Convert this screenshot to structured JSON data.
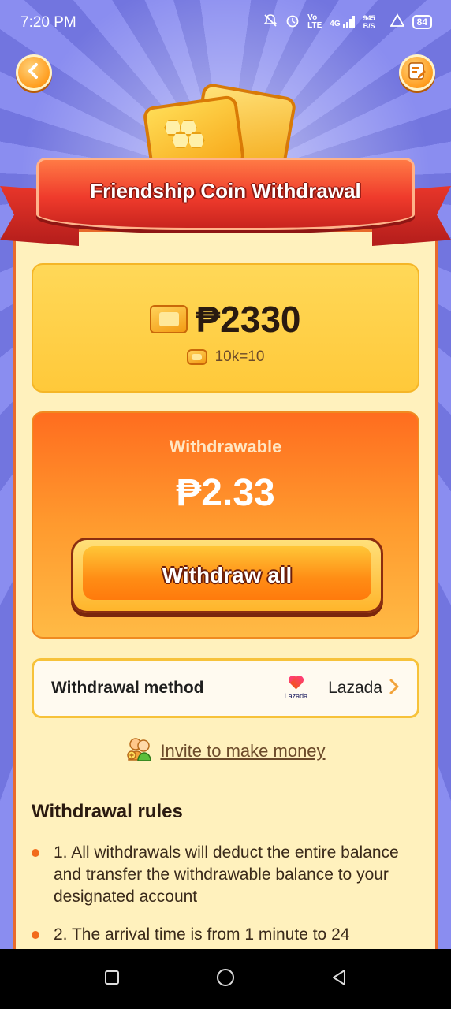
{
  "status_bar": {
    "time": "7:20 PM",
    "network": "4G",
    "speed": "945 B/S",
    "battery": "84"
  },
  "header": {
    "title": "Friendship Coin Withdrawal"
  },
  "balance": {
    "amount": "₱2330",
    "rate": "10k=10"
  },
  "withdrawable": {
    "label": "Withdrawable",
    "amount": "₱2.33",
    "button_label": "Withdraw all"
  },
  "method": {
    "label": "Withdrawal method",
    "logo_text": "Lazada",
    "value": "Lazada"
  },
  "invite": {
    "label": "Invite to make money"
  },
  "rules": {
    "title": "Withdrawal rules",
    "items": [
      "1. All withdrawals will deduct the entire balance and transfer the withdrawable balance to your designated account",
      "2. The arrival time is from 1 minute to 24"
    ]
  },
  "colors": {
    "accent_orange": "#ff7a0c",
    "ribbon_red": "#ef3b2c",
    "panel_bg": "#fff1bd"
  }
}
